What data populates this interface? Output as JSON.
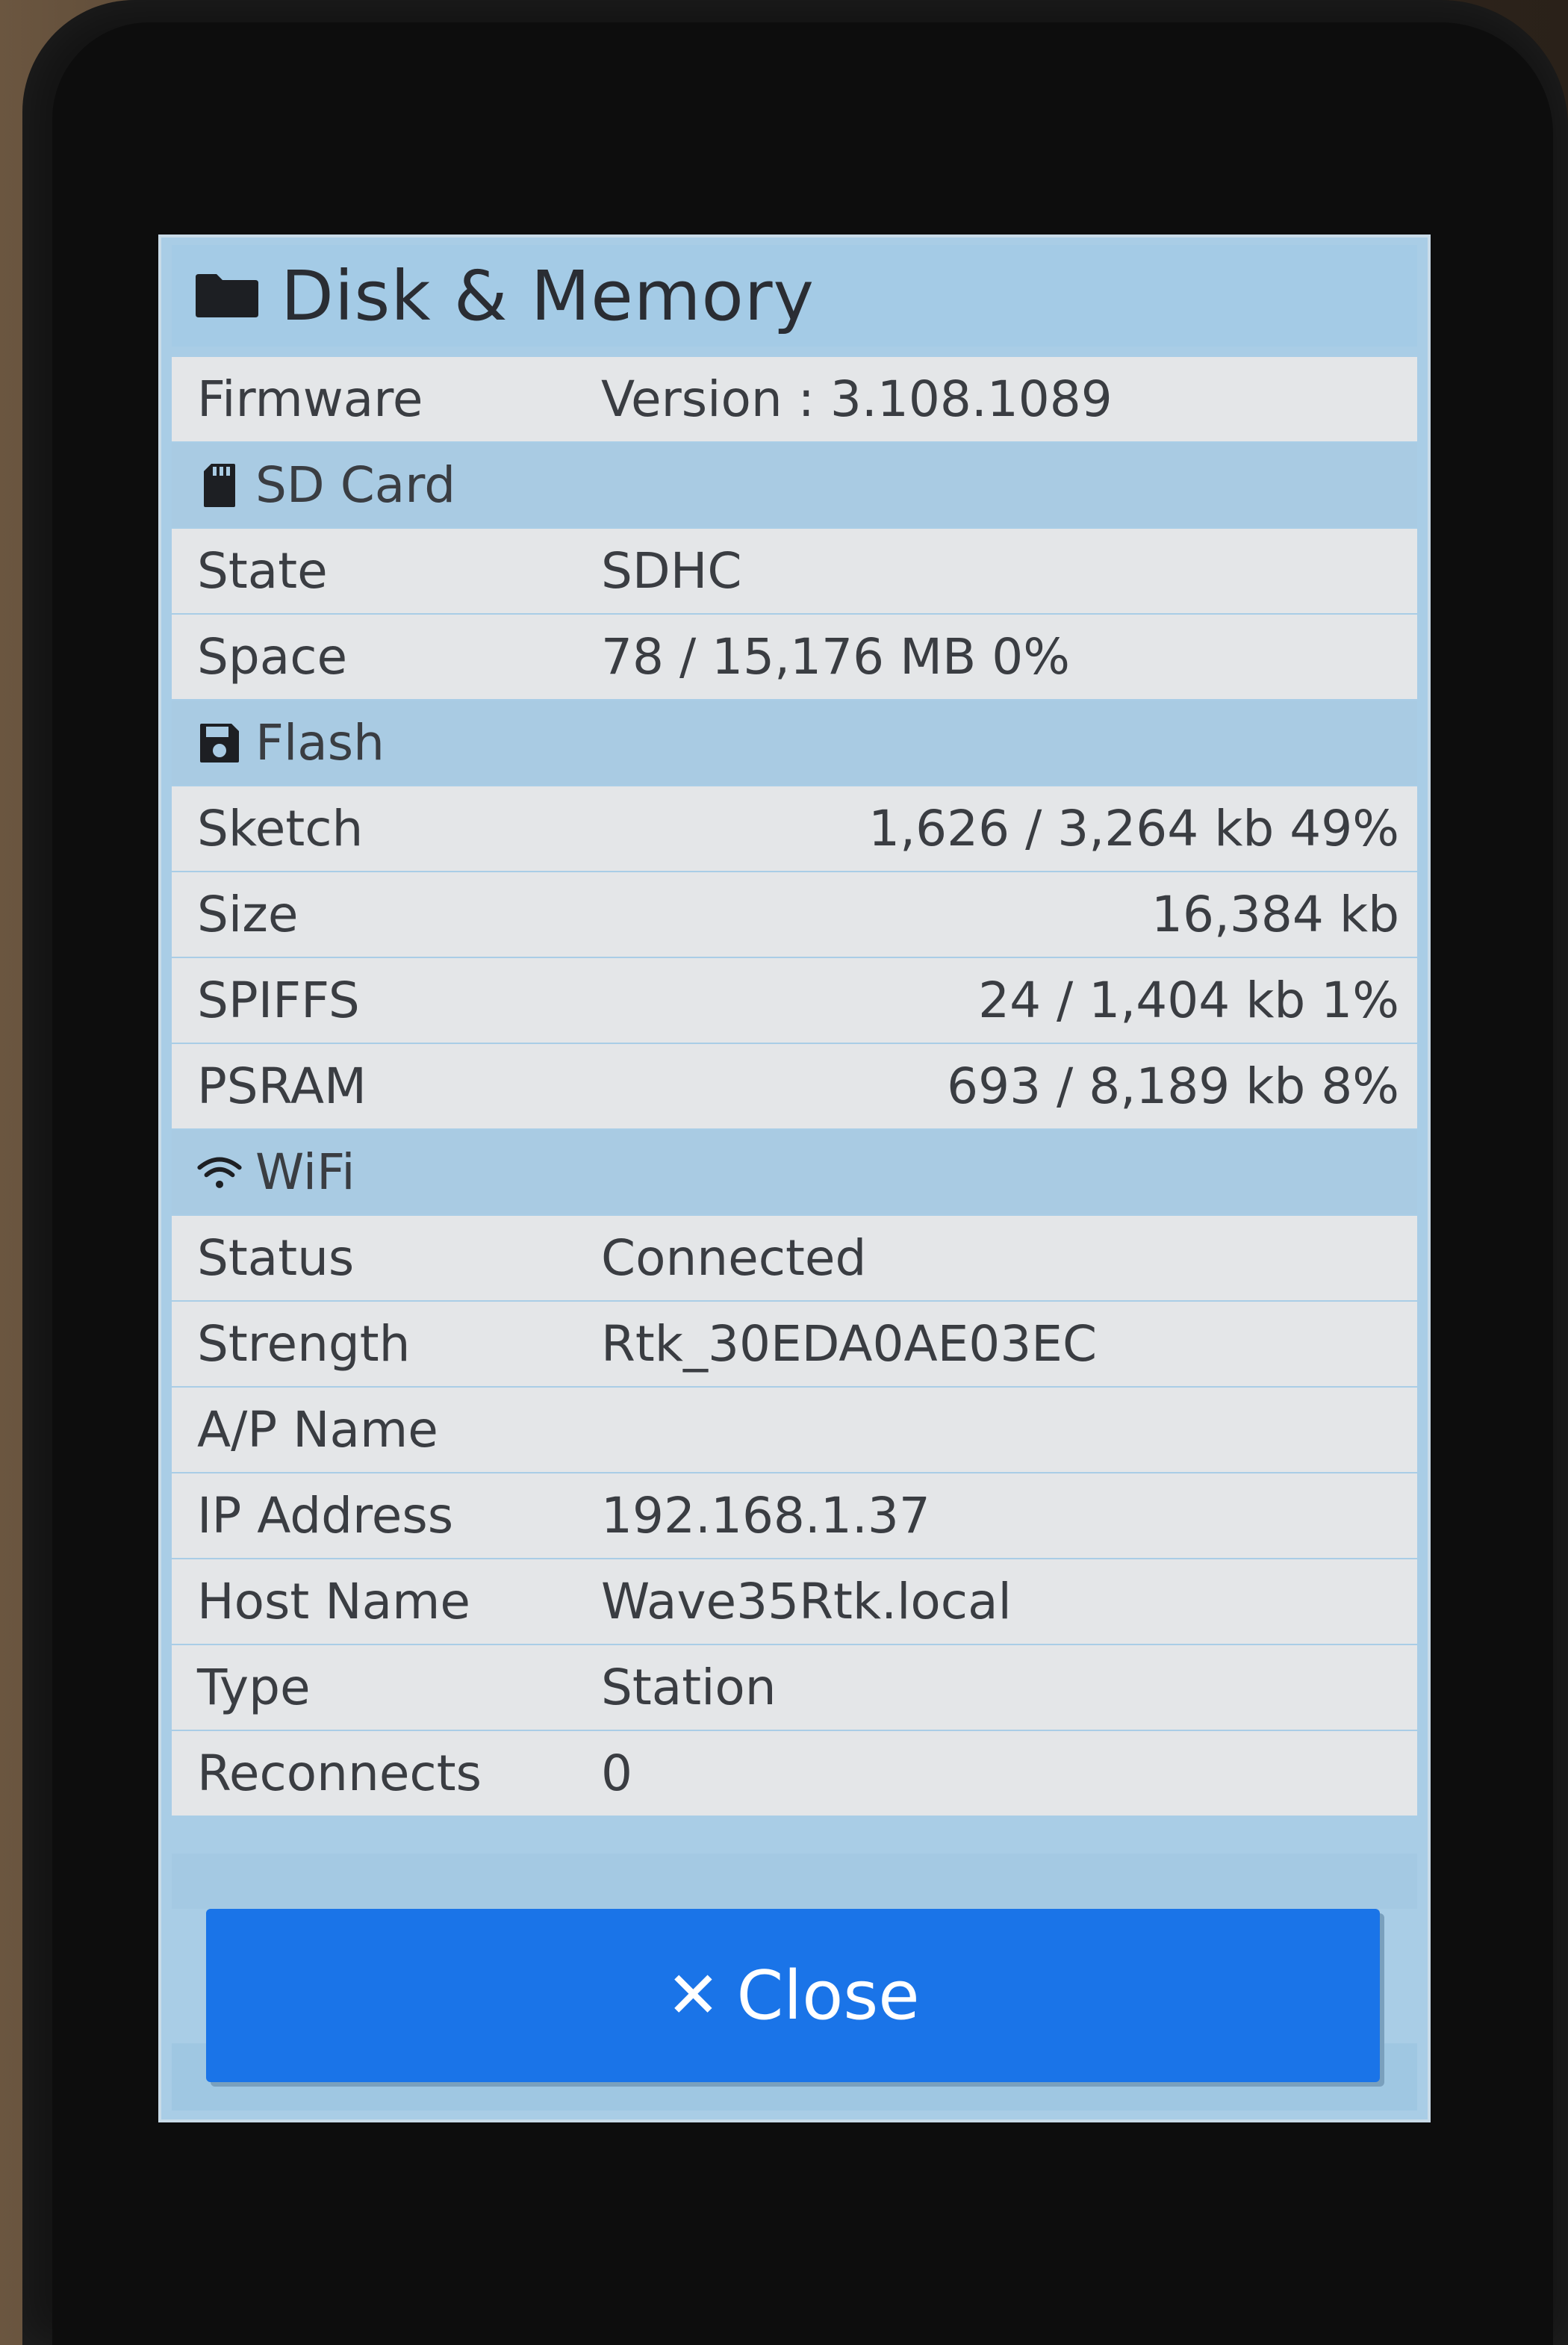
{
  "dialog": {
    "title": "Disk & Memory",
    "close_label": "Close",
    "close_icon": "close-icon"
  },
  "rows": {
    "firmware": {
      "label": "Firmware",
      "value": "Version : 3.108.1089"
    },
    "sd_section": {
      "label": "SD Card",
      "icon": "sd-card-icon"
    },
    "state": {
      "label": "State",
      "value": "SDHC"
    },
    "space": {
      "label": "Space",
      "value": "78 / 15,176 MB 0%"
    },
    "flash_section": {
      "label": "Flash",
      "icon": "floppy-disk-icon"
    },
    "sketch": {
      "label": "Sketch",
      "value": "1,626 / 3,264 kb 49%"
    },
    "size": {
      "label": "Size",
      "value": "16,384 kb"
    },
    "spiffs": {
      "label": "SPIFFS",
      "value": "24 / 1,404 kb 1%"
    },
    "psram": {
      "label": "PSRAM",
      "value": "693 / 8,189 kb 8%"
    },
    "wifi_section": {
      "label": "WiFi",
      "icon": "wifi-icon"
    },
    "status": {
      "label": "Status",
      "value": "Connected"
    },
    "strength": {
      "label": "Strength",
      "value": "Rtk_30EDA0AE03EC"
    },
    "ap_name": {
      "label": "A/P Name",
      "value": ""
    },
    "ip_address": {
      "label": "IP Address",
      "value": "192.168.1.37"
    },
    "host_name": {
      "label": "Host Name",
      "value": "Wave35Rtk.local"
    },
    "type": {
      "label": "Type",
      "value": "Station"
    },
    "reconnects": {
      "label": "Reconnects",
      "value": "0"
    }
  },
  "colors": {
    "header_bg": "#a4cbe6",
    "row_bg": "#e4e6e8",
    "section_bg": "#a9cbe3",
    "button_bg": "#1a74e8"
  }
}
